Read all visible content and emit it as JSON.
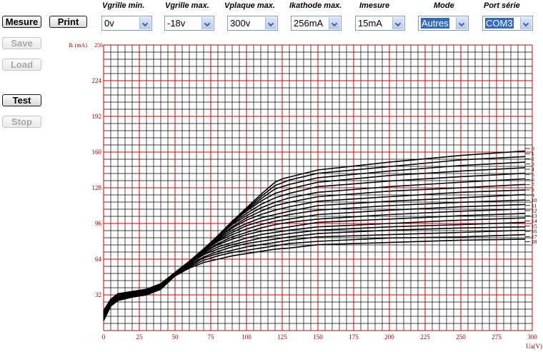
{
  "buttons": {
    "mesure": "Mesure",
    "print": "Print",
    "save": "Save",
    "load": "Load",
    "test": "Test",
    "stop": "Stop"
  },
  "controls": [
    {
      "label": "Vgrille min.",
      "value": "0v"
    },
    {
      "label": "Vgrille max.",
      "value": "-18v"
    },
    {
      "label": "Vplaque max.",
      "value": "300v"
    },
    {
      "label": "Ikathode max.",
      "value": "256mA"
    },
    {
      "label": "Imesure",
      "value": "15mA"
    },
    {
      "label": "Mode",
      "value": "Autres"
    },
    {
      "label": "Port série",
      "value": "COM3"
    }
  ],
  "chart_data": {
    "type": "line",
    "ylabel": "Ik (mA)",
    "xlabel": "Ua(V)",
    "xlim": [
      0,
      300
    ],
    "ylim": [
      0,
      256
    ],
    "xticks": [
      0,
      25,
      50,
      75,
      100,
      125,
      150,
      175,
      200,
      225,
      250,
      275,
      300
    ],
    "yticks": [
      32,
      64,
      96,
      128,
      160,
      192,
      224,
      256
    ],
    "grid": true,
    "colors": {
      "grid_major": "#cc0000",
      "grid_minor": "#000000",
      "curve": "#000000"
    },
    "series": [
      {
        "name": "0",
        "x": [
          0,
          5,
          10,
          20,
          30,
          40,
          50,
          60,
          70,
          80,
          90,
          100,
          110,
          120,
          125,
          150,
          200,
          250,
          295
        ],
        "y": [
          18,
          28,
          33,
          35,
          37,
          42,
          52,
          62,
          73,
          85,
          98,
          110,
          122,
          133,
          136,
          144,
          151,
          157,
          161
        ]
      },
      {
        "name": "1",
        "x": [
          0,
          5,
          10,
          20,
          30,
          40,
          50,
          60,
          70,
          80,
          90,
          100,
          110,
          120,
          130,
          150,
          200,
          250,
          295
        ],
        "y": [
          17,
          28,
          33,
          35,
          37,
          42,
          52,
          62,
          73,
          85,
          98,
          109,
          120,
          130,
          135,
          141,
          147,
          153,
          156
        ]
      },
      {
        "name": "2",
        "x": [
          0,
          5,
          10,
          20,
          30,
          40,
          50,
          60,
          70,
          80,
          90,
          100,
          110,
          120,
          130,
          150,
          200,
          250,
          295
        ],
        "y": [
          17,
          27,
          32,
          34,
          36,
          42,
          52,
          62,
          73,
          85,
          97,
          108,
          118,
          127,
          131,
          137,
          143,
          148,
          151
        ]
      },
      {
        "name": "3",
        "x": [
          0,
          5,
          10,
          20,
          30,
          40,
          50,
          60,
          70,
          80,
          90,
          100,
          110,
          120,
          130,
          150,
          200,
          250,
          295
        ],
        "y": [
          16,
          27,
          32,
          34,
          36,
          41,
          52,
          62,
          73,
          85,
          97,
          107,
          116,
          123,
          127,
          133,
          139,
          143,
          146
        ]
      },
      {
        "name": "4",
        "x": [
          0,
          5,
          10,
          20,
          30,
          40,
          50,
          60,
          70,
          80,
          90,
          100,
          110,
          120,
          130,
          150,
          200,
          250,
          295
        ],
        "y": [
          16,
          27,
          32,
          34,
          36,
          41,
          52,
          62,
          73,
          84,
          96,
          105,
          113,
          119,
          123,
          129,
          134,
          138,
          141
        ]
      },
      {
        "name": "5",
        "x": [
          0,
          5,
          10,
          20,
          30,
          40,
          50,
          60,
          70,
          80,
          90,
          100,
          110,
          120,
          130,
          150,
          200,
          250,
          295
        ],
        "y": [
          15,
          26,
          31,
          34,
          36,
          41,
          52,
          62,
          72,
          84,
          95,
          103,
          110,
          115,
          119,
          124,
          129,
          133,
          136
        ]
      },
      {
        "name": "6",
        "x": [
          0,
          5,
          10,
          20,
          30,
          40,
          50,
          60,
          70,
          80,
          90,
          100,
          110,
          120,
          130,
          150,
          200,
          250,
          295
        ],
        "y": [
          15,
          26,
          31,
          33,
          35,
          41,
          52,
          62,
          72,
          83,
          93,
          101,
          107,
          112,
          115,
          120,
          125,
          128,
          131
        ]
      },
      {
        "name": "7",
        "x": [
          0,
          5,
          10,
          20,
          30,
          40,
          50,
          60,
          70,
          80,
          90,
          100,
          110,
          120,
          130,
          150,
          200,
          250,
          295
        ],
        "y": [
          14,
          26,
          31,
          33,
          35,
          40,
          52,
          62,
          72,
          83,
          92,
          99,
          104,
          108,
          111,
          116,
          120,
          124,
          126
        ]
      },
      {
        "name": "8",
        "x": [
          0,
          5,
          10,
          20,
          30,
          40,
          50,
          60,
          70,
          80,
          90,
          100,
          110,
          120,
          130,
          150,
          200,
          250,
          295
        ],
        "y": [
          14,
          25,
          30,
          33,
          35,
          40,
          52,
          61,
          72,
          82,
          90,
          96,
          101,
          104,
          107,
          112,
          116,
          119,
          122
        ]
      },
      {
        "name": "9",
        "x": [
          0,
          5,
          10,
          20,
          30,
          40,
          50,
          60,
          70,
          80,
          90,
          100,
          110,
          120,
          130,
          150,
          200,
          250,
          295
        ],
        "y": [
          13,
          25,
          30,
          33,
          35,
          40,
          52,
          61,
          71,
          81,
          88,
          94,
          98,
          101,
          104,
          108,
          112,
          115,
          117
        ]
      },
      {
        "name": "10",
        "x": [
          0,
          5,
          10,
          20,
          30,
          40,
          50,
          60,
          70,
          80,
          90,
          100,
          110,
          120,
          130,
          150,
          200,
          250,
          295
        ],
        "y": [
          13,
          25,
          30,
          32,
          34,
          40,
          51,
          61,
          71,
          80,
          86,
          91,
          95,
          98,
          100,
          104,
          108,
          111,
          113
        ]
      },
      {
        "name": "11",
        "x": [
          0,
          5,
          10,
          20,
          30,
          40,
          50,
          60,
          70,
          80,
          90,
          100,
          110,
          120,
          130,
          150,
          200,
          250,
          295
        ],
        "y": [
          12,
          24,
          29,
          32,
          34,
          39,
          51,
          61,
          70,
          78,
          84,
          88,
          92,
          95,
          97,
          100,
          104,
          107,
          109
        ]
      },
      {
        "name": "12",
        "x": [
          0,
          5,
          10,
          20,
          30,
          40,
          50,
          60,
          70,
          80,
          90,
          100,
          110,
          120,
          130,
          150,
          200,
          250,
          295
        ],
        "y": [
          12,
          24,
          29,
          32,
          34,
          39,
          51,
          60,
          70,
          77,
          82,
          86,
          89,
          91,
          93,
          97,
          100,
          103,
          105
        ]
      },
      {
        "name": "13",
        "x": [
          0,
          5,
          10,
          20,
          30,
          40,
          50,
          60,
          70,
          80,
          90,
          100,
          110,
          120,
          130,
          150,
          200,
          250,
          295
        ],
        "y": [
          11,
          24,
          29,
          32,
          34,
          39,
          51,
          60,
          69,
          75,
          79,
          83,
          86,
          88,
          90,
          93,
          96,
          99,
          101
        ]
      },
      {
        "name": "14",
        "x": [
          0,
          5,
          10,
          20,
          30,
          40,
          50,
          60,
          70,
          80,
          90,
          100,
          110,
          120,
          130,
          150,
          200,
          250,
          295
        ],
        "y": [
          11,
          23,
          28,
          31,
          33,
          39,
          51,
          60,
          68,
          73,
          77,
          80,
          83,
          85,
          87,
          90,
          93,
          95,
          97
        ]
      },
      {
        "name": "15",
        "x": [
          0,
          5,
          10,
          20,
          30,
          40,
          50,
          60,
          70,
          80,
          90,
          100,
          110,
          120,
          130,
          150,
          200,
          250,
          295
        ],
        "y": [
          10,
          23,
          28,
          31,
          33,
          38,
          50,
          59,
          66,
          71,
          75,
          78,
          80,
          82,
          84,
          87,
          90,
          92,
          93
        ]
      },
      {
        "name": "16",
        "x": [
          0,
          5,
          10,
          20,
          30,
          40,
          50,
          60,
          70,
          80,
          90,
          100,
          110,
          120,
          130,
          150,
          200,
          250,
          295
        ],
        "y": [
          10,
          23,
          28,
          31,
          33,
          38,
          50,
          58,
          65,
          69,
          72,
          75,
          77,
          79,
          81,
          84,
          86,
          88,
          90
        ]
      },
      {
        "name": "17",
        "x": [
          0,
          5,
          10,
          20,
          30,
          40,
          50,
          60,
          70,
          80,
          90,
          100,
          110,
          120,
          130,
          150,
          200,
          250,
          295
        ],
        "y": [
          9,
          22,
          27,
          30,
          32,
          38,
          50,
          57,
          63,
          67,
          70,
          72,
          74,
          76,
          78,
          80,
          83,
          84,
          86
        ]
      },
      {
        "name": "18",
        "x": [
          0,
          5,
          10,
          20,
          30,
          40,
          50,
          60,
          70,
          80,
          90,
          100,
          110,
          120,
          130,
          150,
          200,
          250,
          295
        ],
        "y": [
          9,
          22,
          27,
          30,
          32,
          37,
          49,
          56,
          61,
          64,
          67,
          69,
          71,
          73,
          74,
          77,
          79,
          81,
          82
        ]
      }
    ]
  }
}
